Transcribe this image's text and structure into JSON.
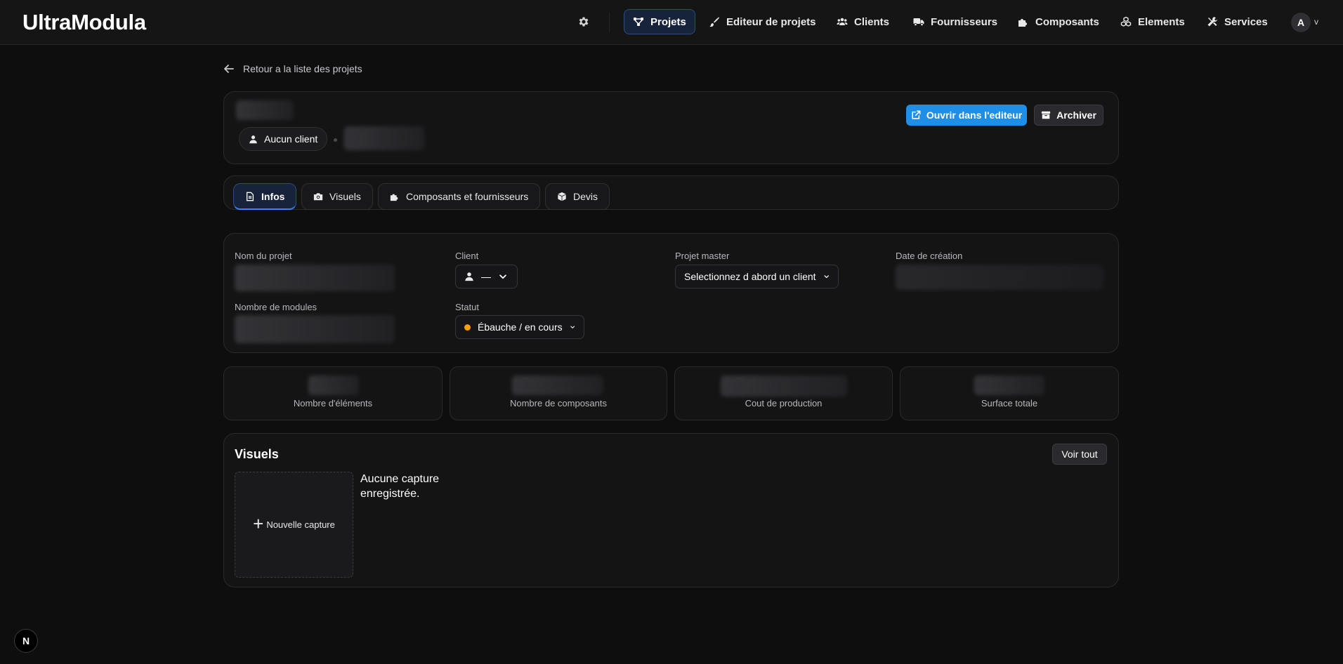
{
  "app": {
    "title": "UltraModula"
  },
  "nav": {
    "settings_icon": "gear-icon",
    "items": [
      {
        "label": "Projets",
        "icon": "project-diagram-icon",
        "active": true
      },
      {
        "label": "Editeur de projets",
        "icon": "brush-icon"
      },
      {
        "label": "Clients",
        "icon": "users-icon"
      },
      {
        "label": "Fournisseurs",
        "icon": "truck-icon"
      },
      {
        "label": "Composants",
        "icon": "puzzle-icon"
      },
      {
        "label": "Elements",
        "icon": "cubes-icon"
      },
      {
        "label": "Services",
        "icon": "tools-icon"
      }
    ],
    "user": {
      "initial": "A",
      "caret": "v"
    }
  },
  "back_link": {
    "label": "Retour a la liste des projets"
  },
  "header": {
    "client_pill": "Aucun client",
    "open_editor_button": "Ouvrir dans l'editeur",
    "archive_button": "Archiver"
  },
  "tabs": [
    {
      "label": "Infos",
      "icon": "document-icon",
      "active": true
    },
    {
      "label": "Visuels",
      "icon": "camera-icon"
    },
    {
      "label": "Composants et fournisseurs",
      "icon": "puzzle-icon"
    },
    {
      "label": "Devis",
      "icon": "box-icon"
    }
  ],
  "info": {
    "project_name_label": "Nom du projet",
    "client_label": "Client",
    "client_value": "—",
    "master_label": "Projet master",
    "master_value": "Selectionnez d abord un client",
    "created_label": "Date de création",
    "modules_label": "Nombre de modules",
    "status_label": "Statut",
    "status_value": "Ébauche / en cours",
    "status_color": "#f59e0b"
  },
  "stats": [
    {
      "label": "Nombre d'éléments"
    },
    {
      "label": "Nombre de composants"
    },
    {
      "label": "Cout de production"
    },
    {
      "label": "Surface totale"
    }
  ],
  "visuals": {
    "title": "Visuels",
    "see_all": "Voir tout",
    "new_capture": "Nouvelle capture",
    "empty": "Aucune capture enregistrée."
  },
  "footer": {
    "badge": "N"
  },
  "colors": {
    "accent": "#1e8ee6",
    "active_tab": "#3b82f6",
    "background": "#0e0e0f"
  }
}
